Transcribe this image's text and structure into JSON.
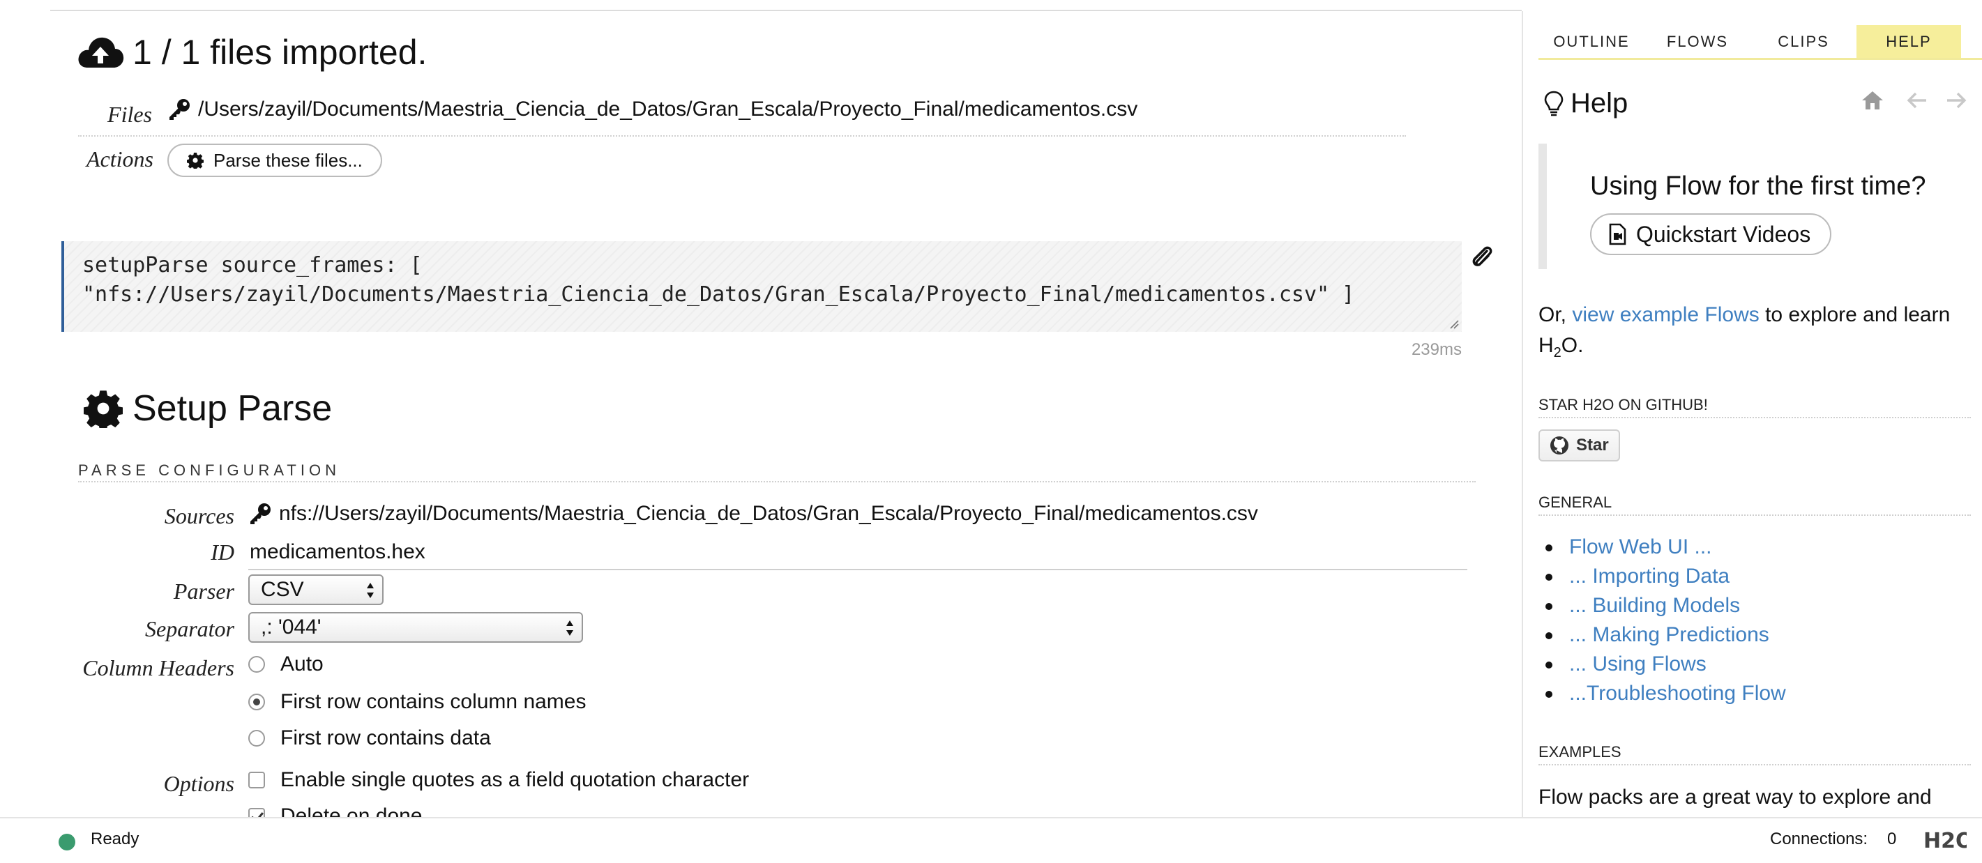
{
  "import": {
    "title": "1 / 1 files imported.",
    "files_label": "Files",
    "file_path": "/Users/zayil/Documents/Maestria_Ciencia_de_Datos/Gran_Escala/Proyecto_Final/medicamentos.csv",
    "actions_label": "Actions",
    "parse_button": "Parse these files..."
  },
  "cell": {
    "code_line1": "setupParse source_frames: [",
    "code_line2": "\"nfs://Users/zayil/Documents/Maestria_Ciencia_de_Datos/Gran_Escala/Proyecto_Final/medicamentos.csv\" ]",
    "timing": "239ms"
  },
  "setup": {
    "title": "Setup Parse",
    "section": "PARSE CONFIGURATION",
    "sources_label": "Sources",
    "sources_value": "nfs://Users/zayil/Documents/Maestria_Ciencia_de_Datos/Gran_Escala/Proyecto_Final/medicamentos.csv",
    "id_label": "ID",
    "id_value": "medicamentos.hex",
    "parser_label": "Parser",
    "parser_value": "CSV",
    "separator_label": "Separator",
    "separator_value": ",: '044'",
    "column_headers_label": "Column Headers",
    "column_headers": [
      {
        "label": "Auto",
        "selected": false
      },
      {
        "label": "First row contains column names",
        "selected": true
      },
      {
        "label": "First row contains data",
        "selected": false
      }
    ],
    "options_label": "Options",
    "options": [
      {
        "label": "Enable single quotes as a field quotation character",
        "checked": false
      },
      {
        "label": "Delete on done",
        "checked": true
      }
    ]
  },
  "sidebar": {
    "tabs": [
      {
        "label": "OUTLINE",
        "active": false
      },
      {
        "label": "FLOWS",
        "active": false
      },
      {
        "label": "CLIPS",
        "active": false
      },
      {
        "label": "HELP",
        "active": true
      }
    ],
    "help_title": "Help",
    "first_time": "Using Flow for the first time?",
    "quickstart_button": "Quickstart Videos",
    "or_text": "Or, ",
    "view_examples_link": "view example Flows",
    "explore_text": " to explore and learn H",
    "h2o_sub": "2",
    "h2o_end": "O.",
    "star_caption": "STAR H2O ON GITHUB!",
    "star_button": "Star",
    "general_caption": "GENERAL",
    "general_links": [
      "Flow Web UI ...",
      "... Importing Data",
      "... Building Models",
      "... Making Predictions",
      "... Using Flows",
      "...Troubleshooting Flow"
    ],
    "examples_caption": "EXAMPLES",
    "flowpacks_text": "Flow packs are a great way to explore and"
  },
  "status": {
    "state": "Ready",
    "connections_label": "Connections:",
    "connections_value": "0",
    "logo_text": "H2O"
  },
  "colors": {
    "accent_tab": "#f6ee9b",
    "link": "#3f7fc0",
    "ready_dot": "#3a9b6e",
    "cell_border": "#2f5e99"
  }
}
